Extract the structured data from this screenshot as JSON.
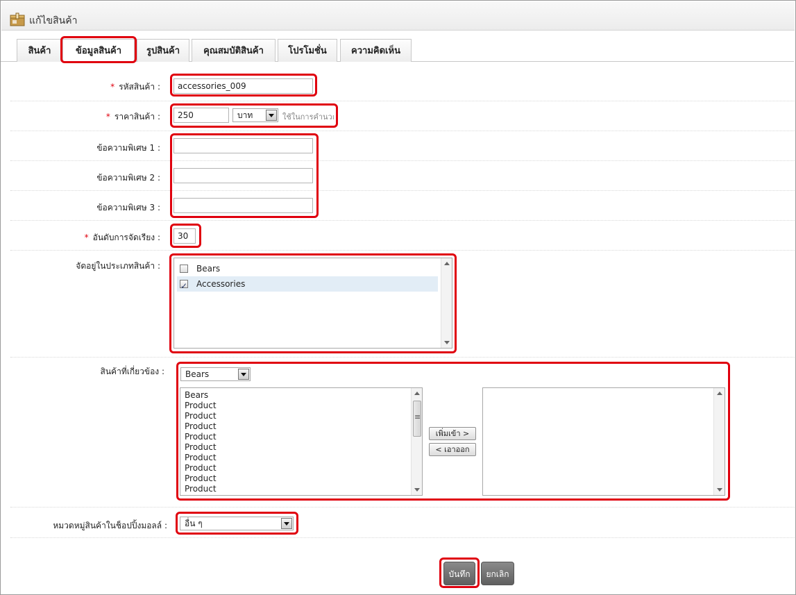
{
  "window": {
    "title": "แก้ไขสินค้า",
    "title_icon": "box-icon"
  },
  "tabs": [
    {
      "label": "สินค้า"
    },
    {
      "label": "ข้อมูลสินค้า"
    },
    {
      "label": "รูปสินค้า"
    },
    {
      "label": "คุณสมบัติสินค้า"
    },
    {
      "label": "โปรโมชั่น"
    },
    {
      "label": "ความคิดเห็น"
    }
  ],
  "form": {
    "required_mark": "*",
    "product_code": {
      "label": "รหัสสินค้า :",
      "value": "accessories_009"
    },
    "price": {
      "label": "ราคาสินค้า :",
      "value": "250",
      "unit": "บาท",
      "hint": "ใช้ในการคำนวณ"
    },
    "special1": {
      "label": "ข้อความพิเศษ 1 :",
      "value": ""
    },
    "special2": {
      "label": "ข้อความพิเศษ 2 :",
      "value": ""
    },
    "special3": {
      "label": "ข้อความพิเศษ 3 :",
      "value": ""
    },
    "sort_order": {
      "label": "อันดับการจัดเรียง :",
      "value": "30"
    },
    "categories": {
      "label": "จัดอยู่ในประเภทสินค้า :",
      "items": [
        {
          "name": "Bears",
          "checked": false
        },
        {
          "name": "Accessories",
          "checked": true
        }
      ]
    },
    "related": {
      "label": "สินค้าที่เกี่ยวข้อง :",
      "filter_value": "Bears",
      "available": [
        "Bears",
        "Product",
        "Product",
        "Product",
        "Product",
        "Product",
        "Product",
        "Product",
        "Product",
        "Product"
      ],
      "add_label": "เพิ่มเข้า >",
      "remove_label": "< เอาออก"
    },
    "mall_category": {
      "label": "หมวดหมู่สินค้าในช็อปปิ้งมอลล์ :",
      "value": "อื่น ๆ"
    }
  },
  "actions": {
    "save_label": "บันทึก",
    "cancel_label": "ยกเลิก"
  },
  "colors": {
    "highlight": "#e0000e",
    "selected_row": "#e2edf6",
    "button_dark": "#6f6f6f"
  }
}
